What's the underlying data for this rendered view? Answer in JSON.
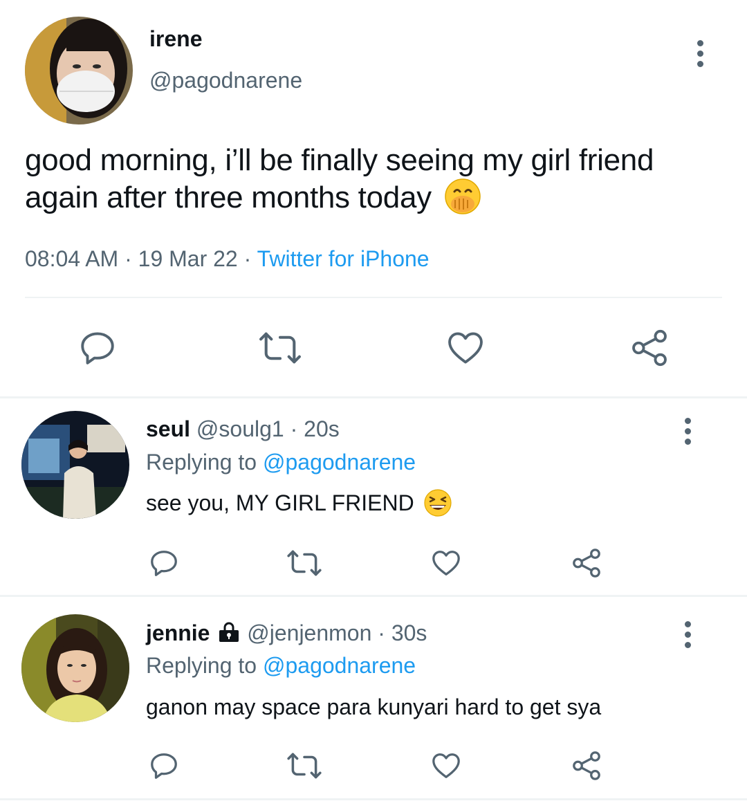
{
  "main_tweet": {
    "display_name": "irene",
    "handle": "@pagodnarene",
    "text_line1": "good morning, i’ll be finally seeing my girl friend",
    "text_line2": "again after three months today",
    "emoji": "hand-over-mouth-emoji",
    "time": "08:04 AM",
    "sep": "·",
    "date": "19 Mar 22",
    "source": "Twitter for iPhone"
  },
  "replies": [
    {
      "display_name": "seul",
      "handle": "@soulg1",
      "sep": "·",
      "age": "20s",
      "replying_prefix": "Replying to",
      "replying_handle": "@pagodnarene",
      "text": "see you, MY GIRL FRIEND",
      "emoji": "grinning-squinting-emoji"
    },
    {
      "display_name": "jennie",
      "badge": "lock-icon",
      "handle": "@jenjenmon",
      "sep": "·",
      "age": "30s",
      "replying_prefix": "Replying to",
      "replying_handle": "@pagodnarene",
      "text": "ganon may space para kunyari hard to get sya"
    }
  ],
  "colors": {
    "text": "#0f1419",
    "secondary": "#536471",
    "link": "#1d9bf0",
    "divider": "#eff3f4"
  }
}
